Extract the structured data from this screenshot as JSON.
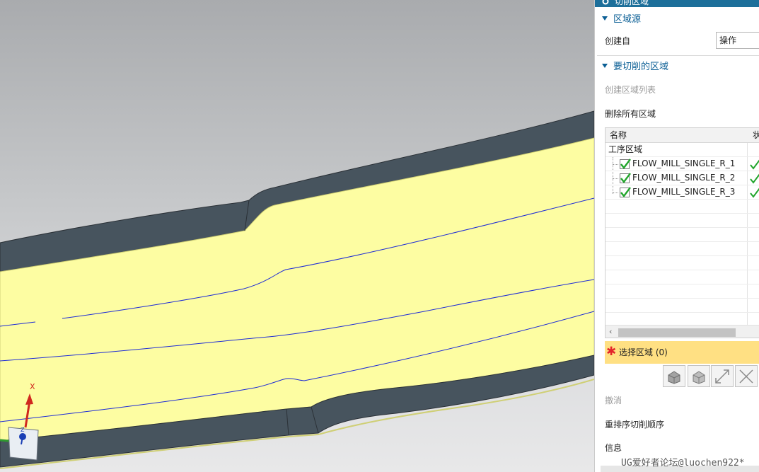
{
  "panel": {
    "title": "切削区域",
    "region_source": {
      "header": "区域源",
      "create_from_label": "创建自",
      "create_from_value": "操作"
    },
    "regions_to_cut": {
      "header": "要切削的区域",
      "create_list_label": "创建区域列表",
      "delete_all_label": "删除所有区域",
      "table": {
        "col_name": "名称",
        "col_state": "状",
        "parent": "工序区域",
        "rows": [
          {
            "name": "FLOW_MILL_SINGLE_R_1",
            "checked": true,
            "state": "ok"
          },
          {
            "name": "FLOW_MILL_SINGLE_R_2",
            "checked": true,
            "state": "ok"
          },
          {
            "name": "FLOW_MILL_SINGLE_R_3",
            "checked": true,
            "state": "ok"
          }
        ]
      },
      "select_region_label": "选择区域 (0)",
      "undo_label": "撤消",
      "reorder_label": "重排序切削顺序",
      "info_label": "信息"
    }
  },
  "viewport": {
    "triad_x_label": "X",
    "triad_z_label": "Z"
  },
  "watermark": "UG爱好者论坛@luochen922*",
  "colors": {
    "title_bar": "#1d6f9a",
    "group_header": "#0b5f95",
    "selection_highlight": "#ffe083",
    "required_star": "#e3242b",
    "check_green": "#22a52c",
    "part_face": "#fdfda2",
    "part_wall": "#47545e",
    "toolpath": "#1d2bd6"
  }
}
